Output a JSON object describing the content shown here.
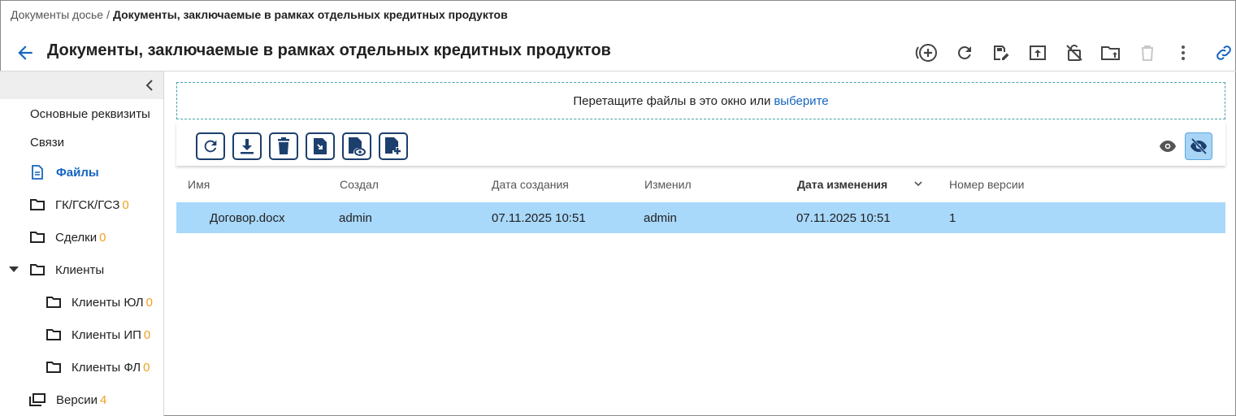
{
  "breadcrumb": {
    "parent": "Документы досье",
    "separator": "/",
    "current": "Документы, заключаемые в рамках отдельных кредитных продуктов"
  },
  "header": {
    "title": "Документы, заключаемые в рамках отдельных кредитных продуктов",
    "actions": [
      "add-circle-icon",
      "refresh-icon",
      "edit-save-icon",
      "upload-icon",
      "lock-off-icon",
      "folder-upload-icon",
      "trash-disabled-icon",
      "more-vertical-icon",
      "link-icon"
    ]
  },
  "sidebar": {
    "items": [
      {
        "label": "Основные реквизиты",
        "count": ""
      },
      {
        "label": "Связи",
        "count": ""
      },
      {
        "label": "Файлы",
        "count": "",
        "active": true
      },
      {
        "label": "ГК/ГСК/ГСЗ",
        "count": "0"
      },
      {
        "label": "Сделки",
        "count": "0"
      },
      {
        "label": "Клиенты",
        "count": "",
        "expanded": true
      },
      {
        "label": "Клиенты ЮЛ",
        "count": "0"
      },
      {
        "label": "Клиенты ИП",
        "count": "0"
      },
      {
        "label": "Клиенты ФЛ",
        "count": "0"
      },
      {
        "label": "Версии",
        "count": "4"
      }
    ]
  },
  "dropzone": {
    "text": "Перетащите файлы в это окно или",
    "link": "выберите"
  },
  "toolbar": {
    "buttons": [
      "refresh-icon",
      "download-icon",
      "delete-icon",
      "file-move-icon",
      "file-preview-icon",
      "file-add-icon"
    ],
    "view_toggles": [
      "eye-icon",
      "eye-off-icon"
    ]
  },
  "table": {
    "columns": [
      "Имя",
      "Создал",
      "Дата создания",
      "Изменил",
      "Дата изменения",
      "Номер версии"
    ],
    "sorted_column": "Дата изменения",
    "rows": [
      {
        "name": "Договор.docx",
        "created_by": "admin",
        "created_at": "07.11.2025 10:51",
        "modified_by": "admin",
        "modified_at": "07.11.2025 10:51",
        "version": "1"
      }
    ]
  },
  "colors": {
    "accent": "#1565c0",
    "count": "#f0a020",
    "selected_row": "#a8d8fa",
    "button_border": "#1c3f6e"
  }
}
